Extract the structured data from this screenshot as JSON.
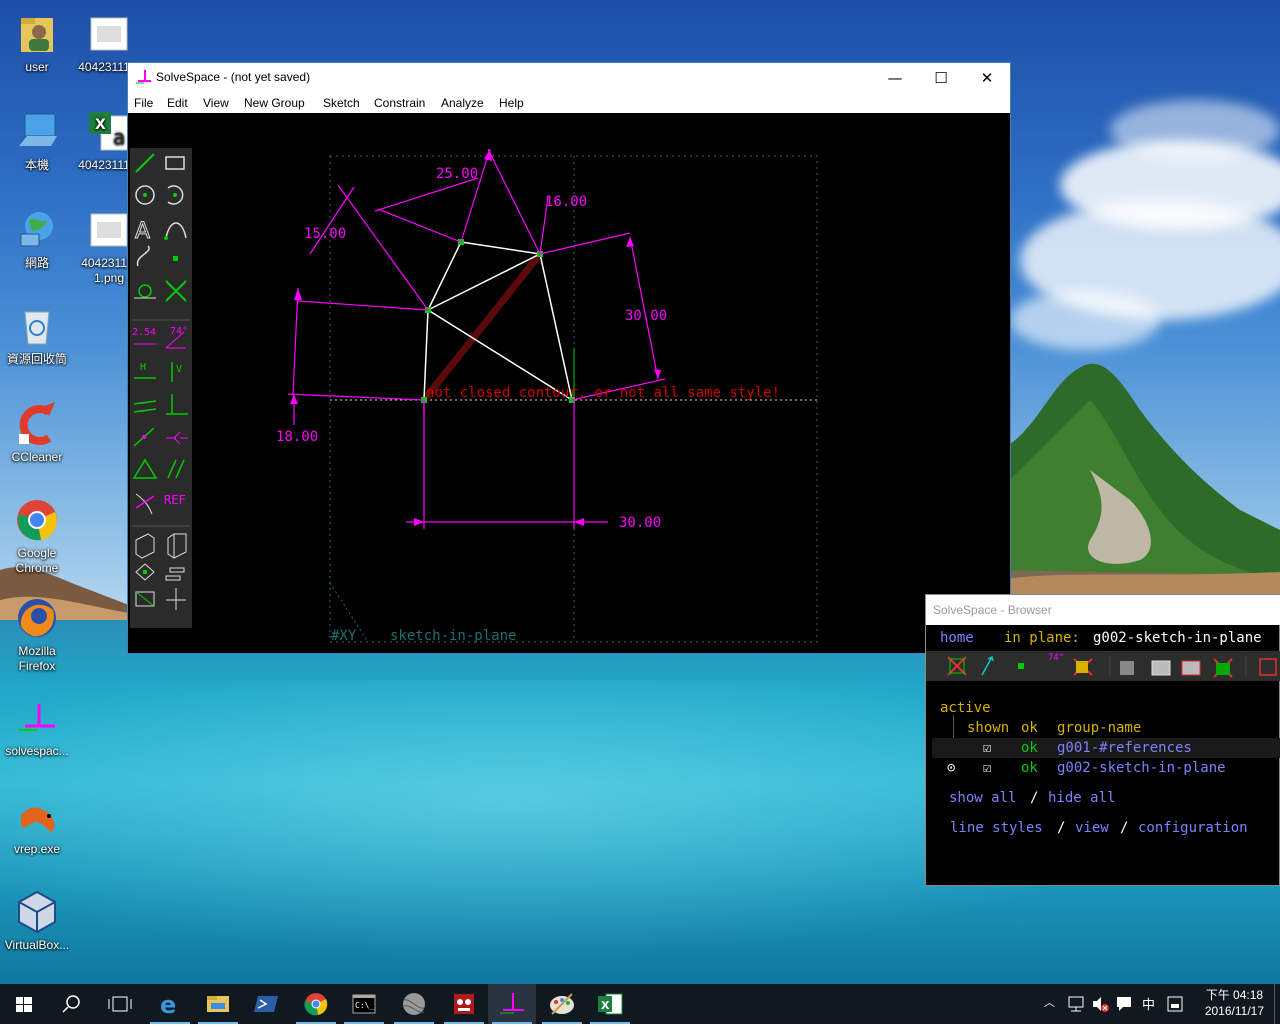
{
  "desktop": {
    "icons": [
      {
        "label": "user"
      },
      {
        "label": "40423111..."
      },
      {
        "label": "本機"
      },
      {
        "label": "40423111..."
      },
      {
        "label": "網路"
      },
      {
        "label": "40423111-1.png"
      },
      {
        "label": "資源回收筒"
      },
      {
        "label": "CCleaner"
      },
      {
        "label": "Google Chrome"
      },
      {
        "label": "Mozilla Firefox"
      },
      {
        "label": "solvespac..."
      },
      {
        "label": "vrep.exe"
      },
      {
        "label": "VirtualBox..."
      }
    ]
  },
  "solvespace": {
    "title": "SolveSpace - (not yet saved)",
    "window_controls": {
      "minimize": "—",
      "maximize": "☐",
      "close": "✕"
    },
    "menu": [
      "File",
      "Edit",
      "View",
      "New Group",
      "Sketch",
      "Constrain",
      "Analyze",
      "Help"
    ],
    "toolbar": {
      "dim_label": "2.54",
      "angle_label": "74°",
      "horizontal_label": "H",
      "vertical_label": "V",
      "ref_label": "REF"
    },
    "dimensions": {
      "d1": "25.00",
      "d2": "16.00",
      "d3": "15.00",
      "d4": "30.00",
      "d5": "18.00",
      "d6": "30.00"
    },
    "error_message": "not closed contour, or not all same style!",
    "workplane_label": "#XY",
    "group_label": "sketch-in-plane",
    "colors": {
      "constraint": "#ff00ff",
      "line": "#ffffff",
      "error": "#cc0000",
      "point": "#00cc00"
    }
  },
  "browser": {
    "title": "SolveSpace - Browser",
    "home_link": "home",
    "in_plane_label": "in plane:",
    "in_plane_value": "g002-sketch-in-plane",
    "toolbar_angle_label": "74°",
    "section_label": "active",
    "columns": {
      "shown": "shown",
      "ok": "ok",
      "group": "group-name"
    },
    "groups": [
      {
        "checked": "☑",
        "ok": "ok",
        "name": "g001-#references",
        "active": false
      },
      {
        "checked": "☑",
        "ok": "ok",
        "name": "g002-sketch-in-plane",
        "active": true
      }
    ],
    "links": {
      "show_all": "show all",
      "sep1": "/",
      "hide_all": "hide all",
      "line_styles": "line styles",
      "sep2": "/",
      "view": "view",
      "sep3": "/",
      "configuration": "configuration"
    }
  },
  "taskbar": {
    "tray": {
      "ime": "中"
    },
    "time": "下午 04:18",
    "date": "2016/11/17"
  }
}
